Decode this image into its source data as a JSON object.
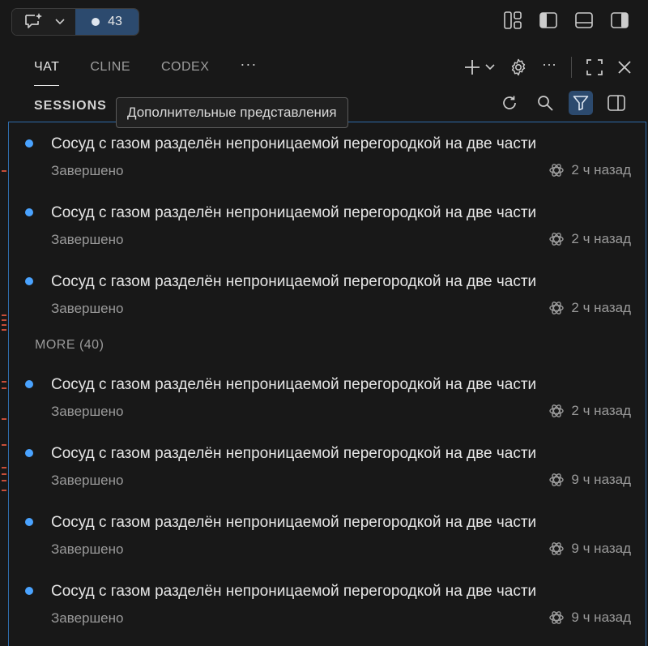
{
  "titlebar": {
    "badge_count": "43",
    "accent_color": "#2c4a6e"
  },
  "tabs": [
    {
      "label": "ЧАТ",
      "active": true
    },
    {
      "label": "CLINE",
      "active": false
    },
    {
      "label": "CODEX",
      "active": false
    }
  ],
  "sessions": {
    "header": "SESSIONS",
    "tooltip": "Дополнительные представления",
    "more_label": "MORE (40)",
    "items": [
      {
        "title": "Сосуд с газом разделён непроницаемой перегородкой на две части",
        "status": "Завершено",
        "time": "2 ч назад"
      },
      {
        "title": "Сосуд с газом разделён непроницаемой перегородкой на две части",
        "status": "Завершено",
        "time": "2 ч назад"
      },
      {
        "title": "Сосуд с газом разделён непроницаемой перегородкой на две части",
        "status": "Завершено",
        "time": "2 ч назад"
      },
      {
        "title": "Сосуд с газом разделён непроницаемой перегородкой на две части",
        "status": "Завершено",
        "time": "2 ч назад"
      },
      {
        "title": "Сосуд с газом разделён непроницаемой перегородкой на две части",
        "status": "Завершено",
        "time": "9 ч назад"
      },
      {
        "title": "Сосуд с газом разделён непроницаемой перегородкой на две части",
        "status": "Завершено",
        "time": "9 ч назад"
      },
      {
        "title": "Сосуд с газом разделён непроницаемой перегородкой на две части",
        "status": "Завершено",
        "time": "9 ч назад"
      }
    ]
  },
  "icons": {
    "chat": "chat-sparkle-icon",
    "status_dot_color": "#4aa3ff"
  }
}
